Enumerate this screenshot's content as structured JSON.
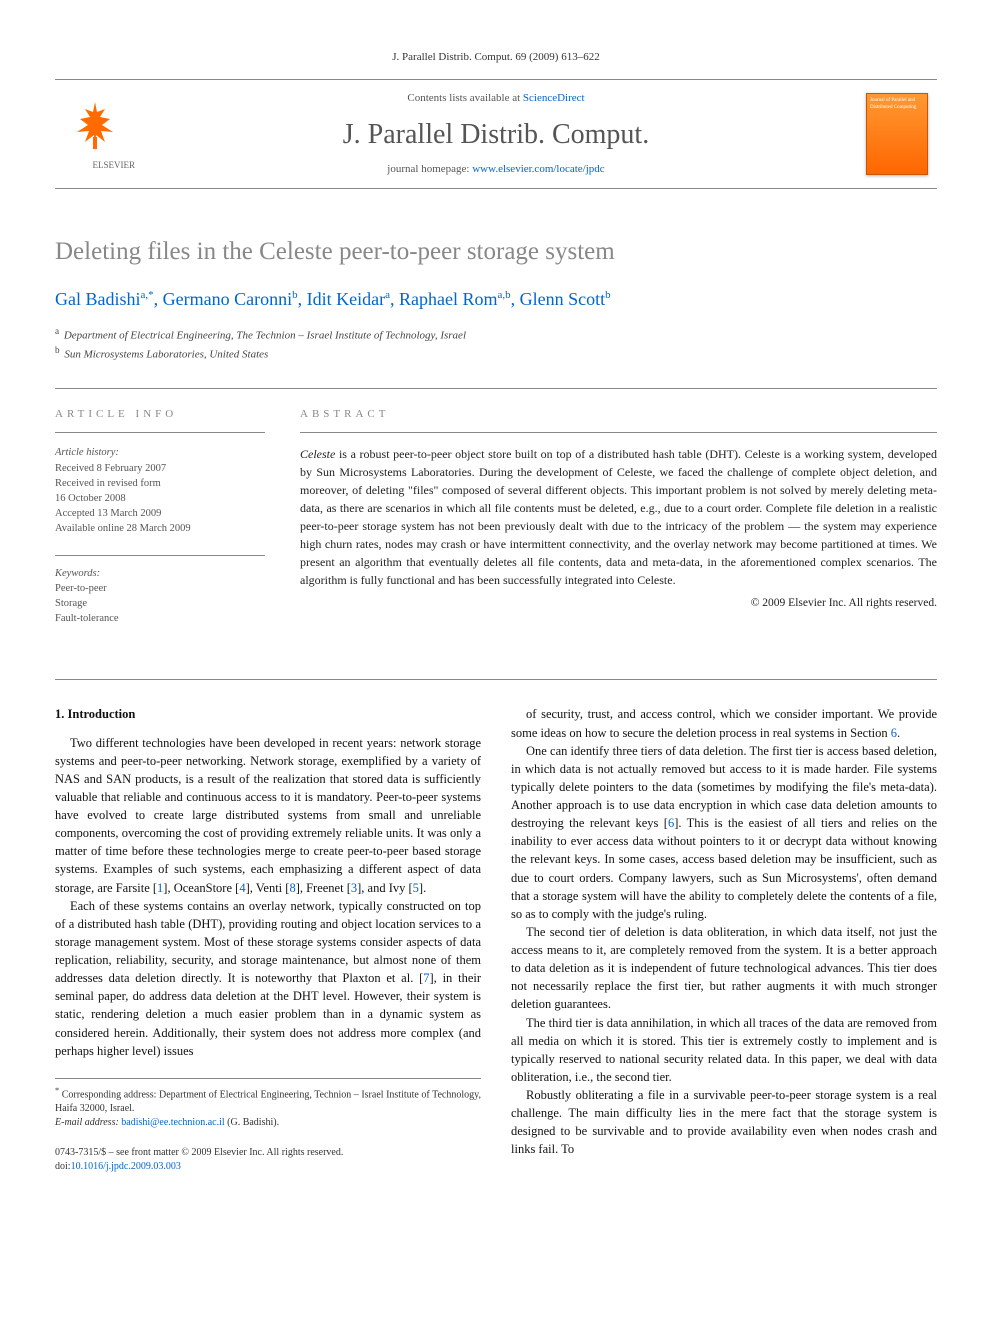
{
  "header": {
    "citation": "J. Parallel Distrib. Comput. 69 (2009) 613–622"
  },
  "masthead": {
    "contents_prefix": "Contents lists available at ",
    "contents_link": "ScienceDirect",
    "journal_name": "J. Parallel Distrib. Comput.",
    "homepage_prefix": "journal homepage: ",
    "homepage_link": "www.elsevier.com/locate/jpdc",
    "publisher_name": "ELSEVIER",
    "cover_text": "Journal of Parallel and Distributed Computing"
  },
  "article": {
    "title": "Deleting files in the Celeste peer-to-peer storage system",
    "authors_html": "Gal Badishi<sup>a,*</sup>, Germano Caronni<sup>b</sup>, Idit Keidar<sup>a</sup>, Raphael Rom<sup>a,b</sup>, Glenn Scott<sup>b</sup>",
    "affiliations": [
      {
        "mark": "a",
        "text": "Department of Electrical Engineering, The Technion – Israel Institute of Technology, Israel"
      },
      {
        "mark": "b",
        "text": "Sun Microsystems Laboratories, United States"
      }
    ]
  },
  "info": {
    "heading": "ARTICLE INFO",
    "history_label": "Article history:",
    "history": [
      "Received 8 February 2007",
      "Received in revised form",
      "16 October 2008",
      "Accepted 13 March 2009",
      "Available online 28 March 2009"
    ],
    "keywords_label": "Keywords:",
    "keywords": [
      "Peer-to-peer",
      "Storage",
      "Fault-tolerance"
    ]
  },
  "abstract": {
    "heading": "ABSTRACT",
    "text": "Celeste is a robust peer-to-peer object store built on top of a distributed hash table (DHT). Celeste is a working system, developed by Sun Microsystems Laboratories. During the development of Celeste, we faced the challenge of complete object deletion, and moreover, of deleting \"files\" composed of several different objects. This important problem is not solved by merely deleting meta-data, as there are scenarios in which all file contents must be deleted, e.g., due to a court order. Complete file deletion in a realistic peer-to-peer storage system has not been previously dealt with due to the intricacy of the problem — the system may experience high churn rates, nodes may crash or have intermittent connectivity, and the overlay network may become partitioned at times. We present an algorithm that eventually deletes all file contents, data and meta-data, in the aforementioned complex scenarios. The algorithm is fully functional and has been successfully integrated into Celeste.",
    "copyright": "© 2009 Elsevier Inc. All rights reserved."
  },
  "body": {
    "section_heading": "1. Introduction",
    "col1_paras": [
      "Two different technologies have been developed in recent years: network storage systems and peer-to-peer networking. Network storage, exemplified by a variety of NAS and SAN products, is a result of the realization that stored data is sufficiently valuable that reliable and continuous access to it is mandatory. Peer-to-peer systems have evolved to create large distributed systems from small and unreliable components, overcoming the cost of providing extremely reliable units. It was only a matter of time before these technologies merge to create peer-to-peer based storage systems. Examples of such systems, each emphasizing a different aspect of data storage, are Farsite [1], OceanStore [4], Venti [8], Freenet [3], and Ivy [5].",
      "Each of these systems contains an overlay network, typically constructed on top of a distributed hash table (DHT), providing routing and object location services to a storage management system. Most of these storage systems consider aspects of data replication, reliability, security, and storage maintenance, but almost none of them addresses data deletion directly. It is noteworthy that Plaxton et al. [7], in their seminal paper, do address data deletion at the DHT level. However, their system is static, rendering deletion a much easier problem than in a dynamic system as considered herein. Additionally, their system does not address more complex (and perhaps higher level) issues"
    ],
    "col2_paras": [
      "of security, trust, and access control, which we consider important. We provide some ideas on how to secure the deletion process in real systems in Section 6.",
      "One can identify three tiers of data deletion. The first tier is access based deletion, in which data is not actually removed but access to it is made harder. File systems typically delete pointers to the data (sometimes by modifying the file's meta-data). Another approach is to use data encryption in which case data deletion amounts to destroying the relevant keys [6]. This is the easiest of all tiers and relies on the inability to ever access data without pointers to it or decrypt data without knowing the relevant keys. In some cases, access based deletion may be insufficient, such as due to court orders. Company lawyers, such as Sun Microsystems', often demand that a storage system will have the ability to completely delete the contents of a file, so as to comply with the judge's ruling.",
      "The second tier of deletion is data obliteration, in which data itself, not just the access means to it, are completely removed from the system. It is a better approach to data deletion as it is independent of future technological advances. This tier does not necessarily replace the first tier, but rather augments it with much stronger deletion guarantees.",
      "The third tier is data annihilation, in which all traces of the data are removed from all media on which it is stored. This tier is extremely costly to implement and is typically reserved to national security related data. In this paper, we deal with data obliteration, i.e., the second tier.",
      "Robustly obliterating a file in a survivable peer-to-peer storage system is a real challenge. The main difficulty lies in the mere fact that the storage system is designed to be survivable and to provide availability even when nodes crash and links fail. To"
    ]
  },
  "footnotes": {
    "corresponding": "Corresponding address: Department of Electrical Engineering, Technion – Israel Institute of Technology, Haifa 32000, Israel.",
    "email_label": "E-mail address:",
    "email": "badishi@ee.technion.ac.il",
    "email_person": "(G. Badishi)."
  },
  "footer": {
    "line1": "0743-7315/$ – see front matter © 2009 Elsevier Inc. All rights reserved.",
    "doi_label": "doi:",
    "doi": "10.1016/j.jpdc.2009.03.003"
  }
}
